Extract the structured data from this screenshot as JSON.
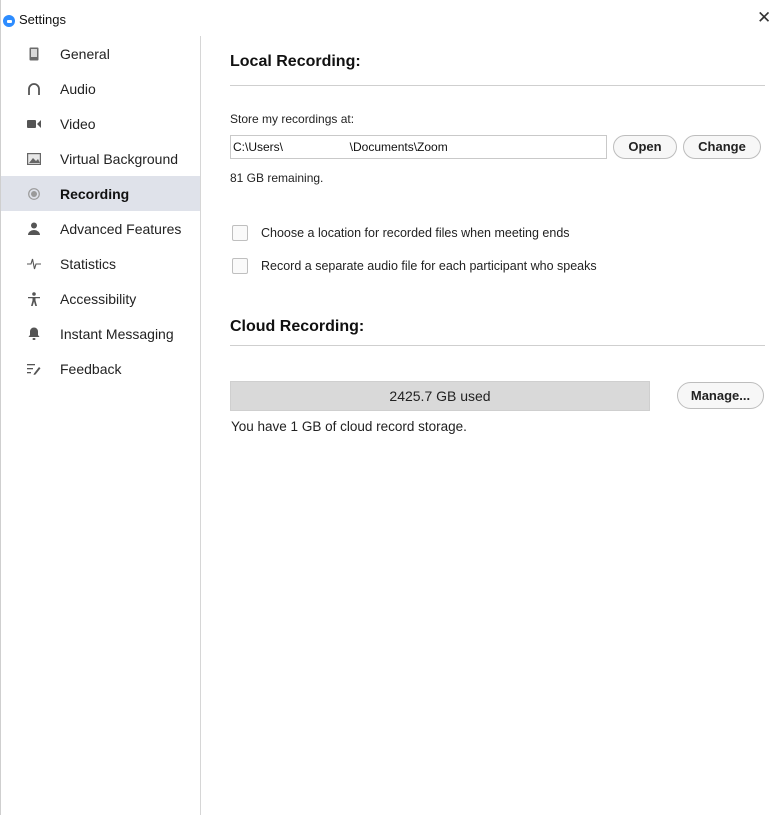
{
  "window": {
    "title": "Settings",
    "close_glyph": "✕"
  },
  "sidebar": {
    "items": [
      {
        "label": "General",
        "icon": "phone-icon",
        "active": false
      },
      {
        "label": "Audio",
        "icon": "headphones-icon",
        "active": false
      },
      {
        "label": "Video",
        "icon": "video-camera-icon",
        "active": false
      },
      {
        "label": "Virtual Background",
        "icon": "picture-icon",
        "active": false
      },
      {
        "label": "Recording",
        "icon": "record-icon",
        "active": true
      },
      {
        "label": "Advanced Features",
        "icon": "user-icon",
        "active": false
      },
      {
        "label": "Statistics",
        "icon": "pulse-icon",
        "active": false
      },
      {
        "label": "Accessibility",
        "icon": "accessibility-icon",
        "active": false
      },
      {
        "label": "Instant Messaging",
        "icon": "bell-icon",
        "active": false
      },
      {
        "label": "Feedback",
        "icon": "feedback-icon",
        "active": false
      }
    ]
  },
  "local_recording": {
    "title": "Local Recording:",
    "store_label": "Store my recordings at:",
    "path_value": "C:\\Users\\                    \\Documents\\Zoom",
    "open_label": "Open",
    "change_label": "Change",
    "remaining": "81 GB remaining.",
    "options": [
      {
        "label": "Choose a location for recorded files when meeting ends",
        "checked": false
      },
      {
        "label": "Record a separate audio file for each participant who speaks",
        "checked": false
      }
    ]
  },
  "cloud_recording": {
    "title": "Cloud Recording:",
    "usage_text": "2425.7 GB used",
    "manage_label": "Manage...",
    "storage_note": "You have 1 GB of cloud record storage."
  },
  "colors": {
    "accent": "#2d8cff",
    "active_nav_bg": "#dfe2ea",
    "usage_bar": "#d9d9d9"
  }
}
